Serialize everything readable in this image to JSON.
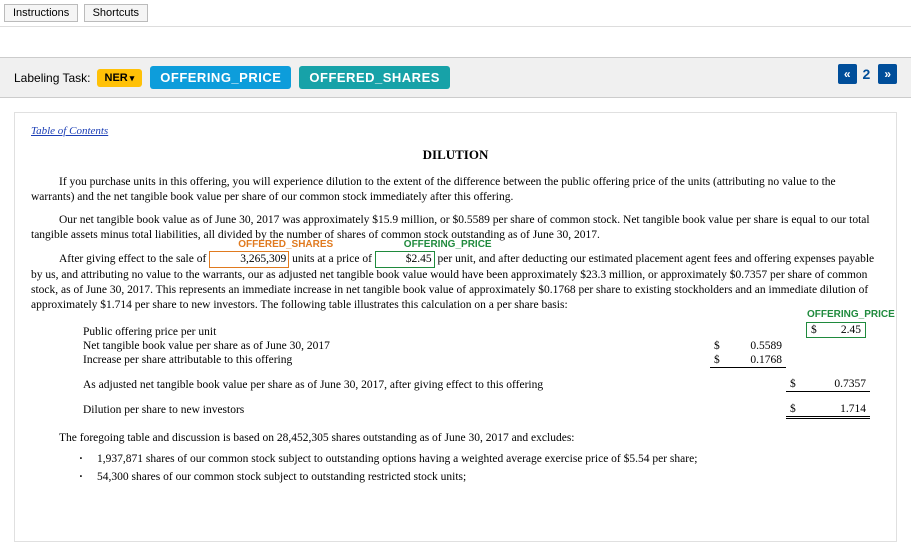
{
  "toolbar": {
    "instructions": "Instructions",
    "shortcuts": "Shortcuts"
  },
  "task": {
    "label": "Labeling Task:",
    "badge": "NER",
    "entities": {
      "price": "OFFERING_PRICE",
      "shares": "OFFERED_SHARES"
    }
  },
  "pager": {
    "prev": "«",
    "current": "2",
    "next": "»"
  },
  "doc": {
    "toc": "Table of Contents",
    "title": "DILUTION",
    "p1": "If you purchase units in this offering, you will experience dilution to the extent of the difference between the public offering price of the units (attributing no value to the warrants) and the net tangible book value per share of our common stock immediately after this offering.",
    "p2": "Our net tangible book value as of June 30, 2017 was approximately $15.9 million, or $0.5589 per share of common stock. Net tangible book value per share is equal to our total tangible assets minus total liabilities, all divided by the number of shares of common stock outstanding as of June 30, 2017.",
    "p3_a": "After giving effect to the sale of ",
    "p3_shares": "3,265,309",
    "p3_b": " units at a price of ",
    "p3_price": "$2.45",
    "p3_c": " per unit, and after deducting our estimated placement agent fees and offering expenses payable by us, and attributing no value to the warrants, our as adjusted net tangible book value would have been approximately $23.3 million, or approximately $0.7357 per share of common stock, as of June 30, 2017. This represents an immediate increase in net tangible book value of approximately $0.1768 per share to existing stockholders and an immediate dilution of approximately $1.714 per share to new investors. The following table illustrates this calculation on a per share basis:",
    "inline_labels": {
      "shares": "OFFERED_SHARES",
      "price": "OFFERING_PRICE",
      "price2": "OFFERING_PRICE"
    },
    "table": {
      "r1": "Public offering price per unit",
      "r2": "Net tangible book value per share as of June 30, 2017",
      "r3": "Increase per share attributable to this offering",
      "r4": "As adjusted net tangible book value per share as of June 30, 2017, after giving effect to this offering",
      "r5": "Dilution per share to new investors",
      "v_price": "2.45",
      "v2": "0.5589",
      "v3": "0.1768",
      "v4": "0.7357",
      "v5": "1.714",
      "dollar": "$"
    },
    "p4": "The foregoing table and discussion is based on 28,452,305 shares outstanding as of June 30, 2017 and excludes:",
    "exc1": "1,937,871 shares of our common stock subject to outstanding options having a weighted average exercise price of $5.54 per share;",
    "exc2": "54,300 shares of our common stock subject to outstanding restricted stock units;"
  }
}
